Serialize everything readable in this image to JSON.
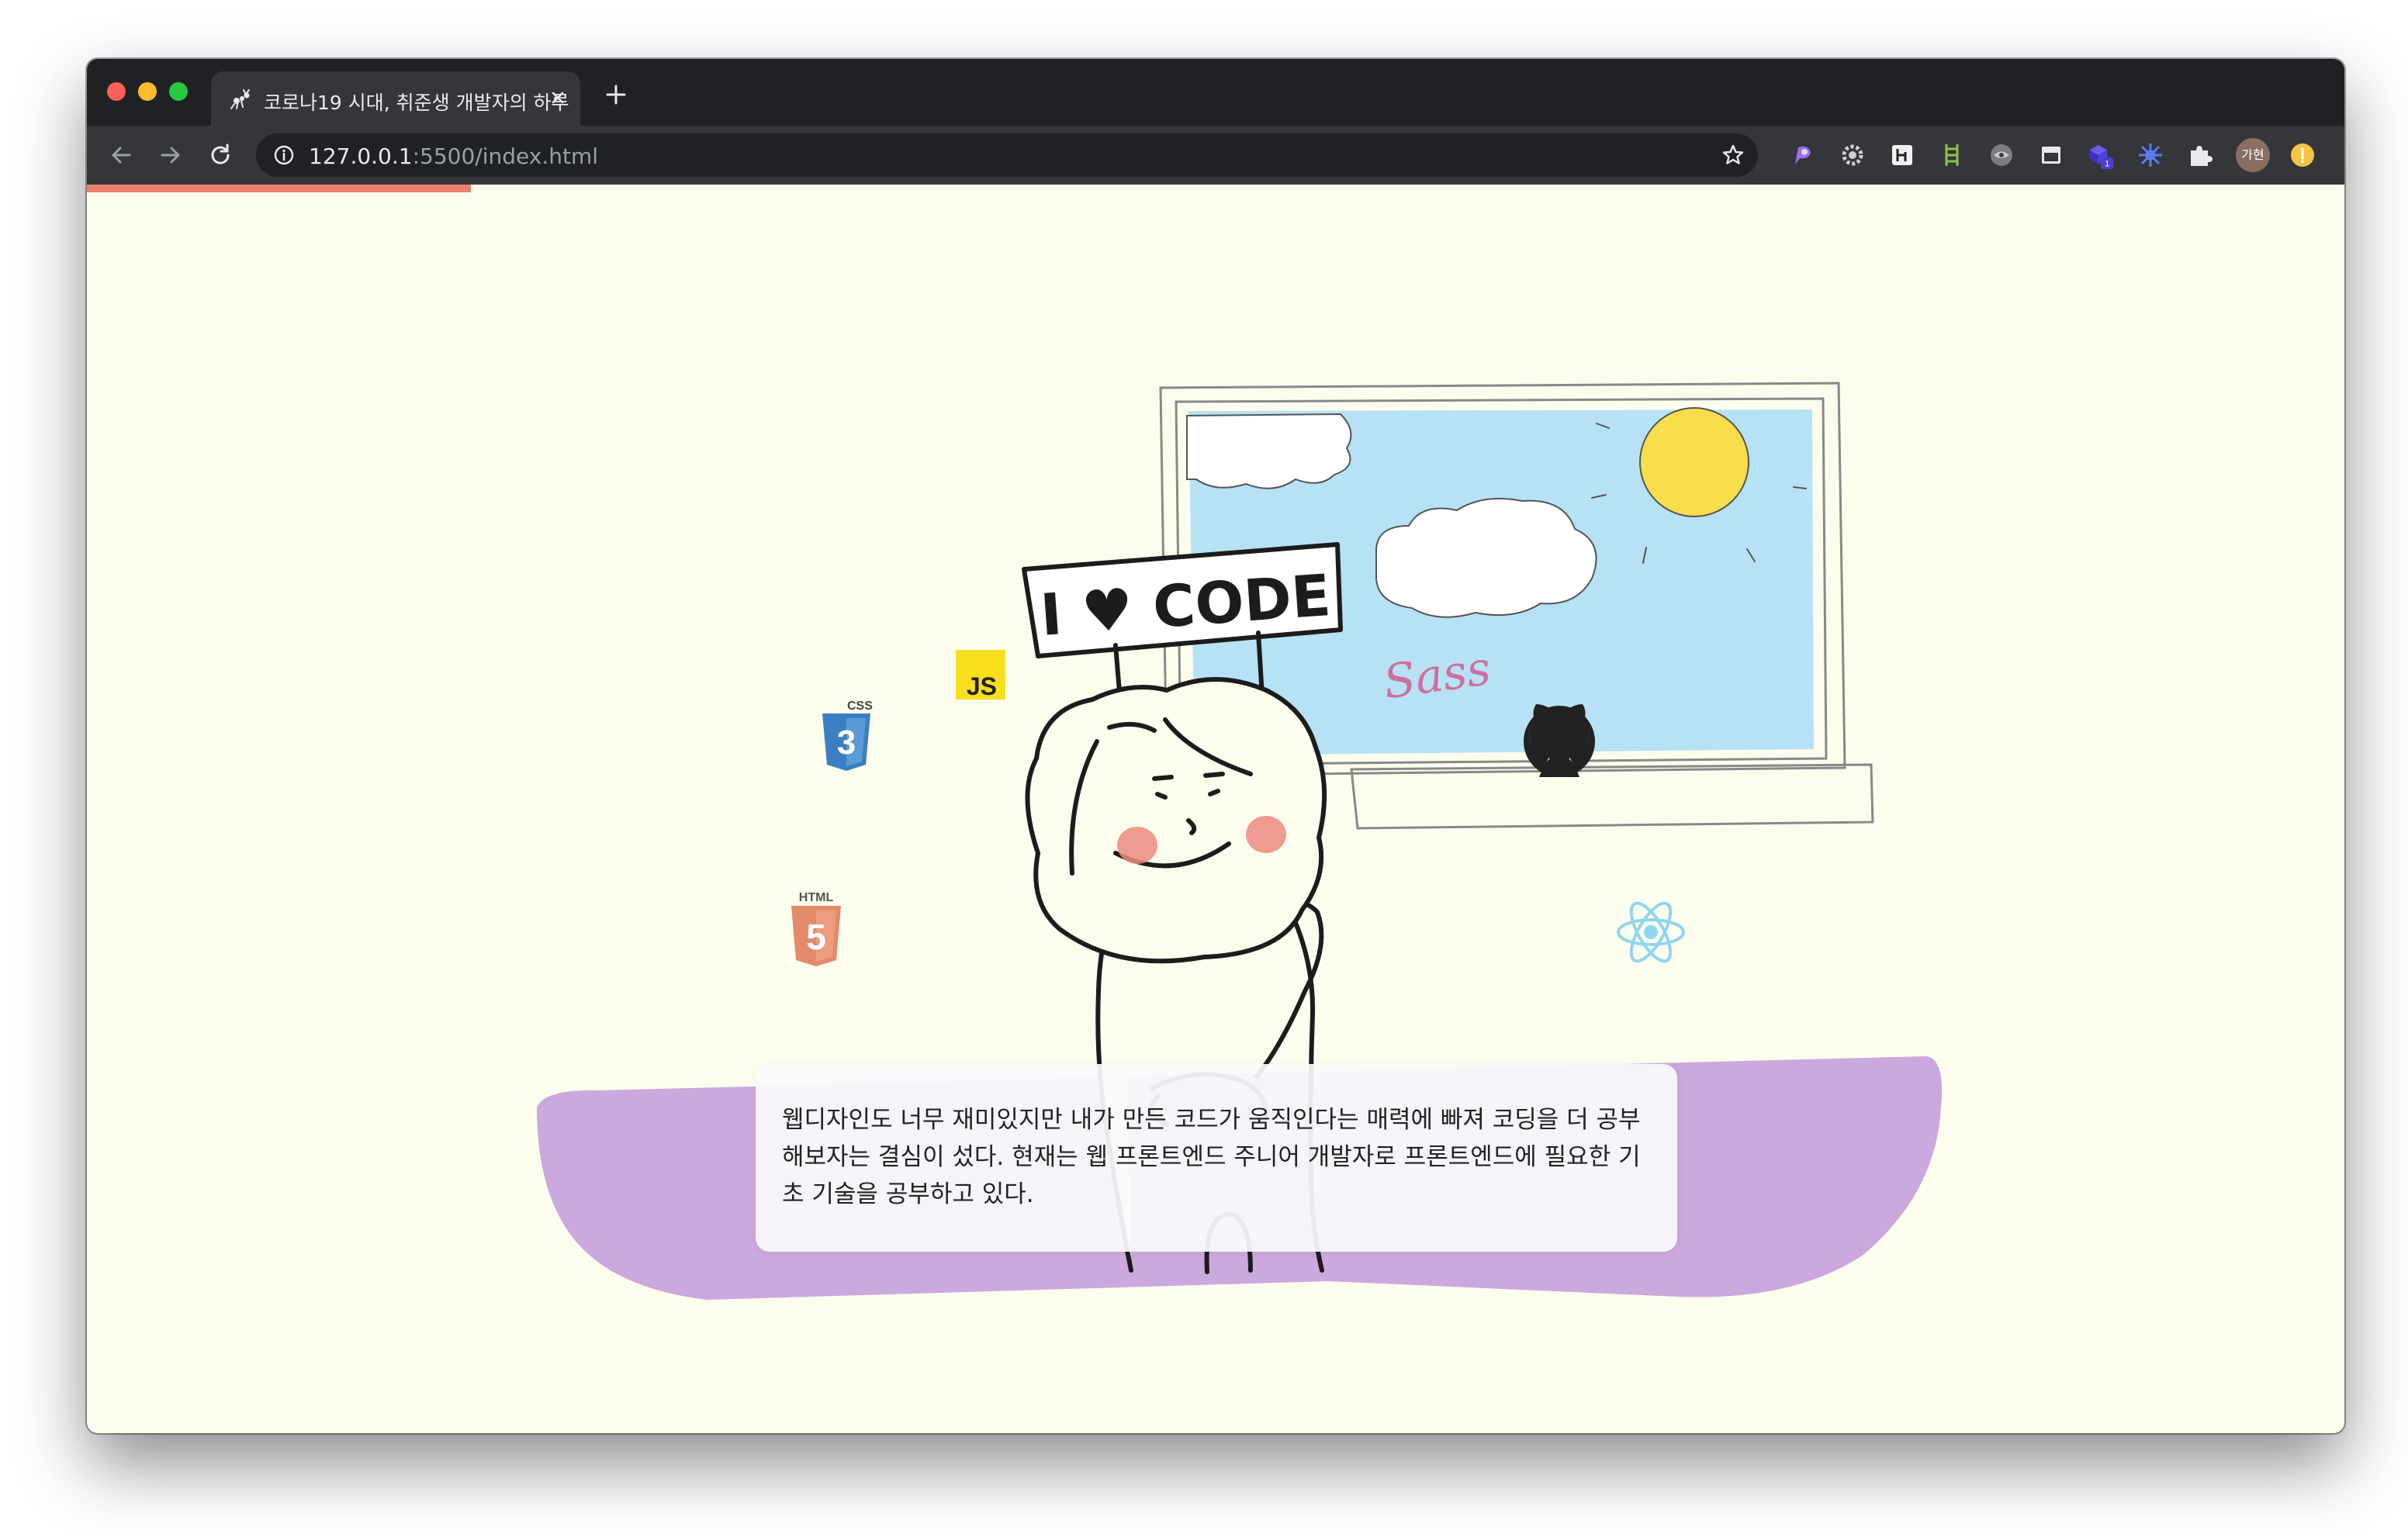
{
  "browser": {
    "tab": {
      "title": "코로나19 시대, 취준생 개발자의 하루"
    },
    "url": {
      "host": "127.0.0.1",
      "rest": ":5500/index.html"
    },
    "profile_avatar_label": "가현",
    "extension_badge": "1",
    "extensions": [
      "purple-extension-icon",
      "gear-extension-icon",
      "h-extension-icon",
      "ladder-extension-icon",
      "eye-extension-icon",
      "window-extension-icon",
      "cube-extension-icon",
      "flower-extension-icon",
      "puzzle-icon"
    ],
    "page_load_progress": 0.17
  },
  "illustration": {
    "sign_text": "I ♥ CODE",
    "tech_icons": {
      "css_label": "CSS",
      "css_digit": "3",
      "js_label": "JS",
      "html_label": "HTML",
      "html_digit": "5",
      "sass_label": "Sass"
    }
  },
  "speech_bubble": {
    "text": "웹디자인도 너무 재미있지만 내가 만든 코드가 움직인다는 매력에 빠져 코딩을 더 공부해보자는 결심이 섰다. 현재는 웹 프론트엔드 주니어 개발자로 프론트엔드에 필요한 기초 기술을 공부하고 있다."
  },
  "colors": {
    "page_background": "#fdfdee",
    "progress_bar": "#ec7e6e",
    "floor": "#cba8de",
    "sky": "#b7e2f5",
    "sun": "#f9de4c",
    "cheeks": "#ec8a80",
    "heart": "#e7626a",
    "css_blue": "#3b7ec1",
    "js_yellow": "#f7df1e",
    "html_orange": "#e38a6a",
    "react_blue": "#8fd6f0",
    "sass_pink": "#cf6f9c",
    "chrome_dark": "#202124",
    "chrome_toolbar": "#35363a"
  }
}
